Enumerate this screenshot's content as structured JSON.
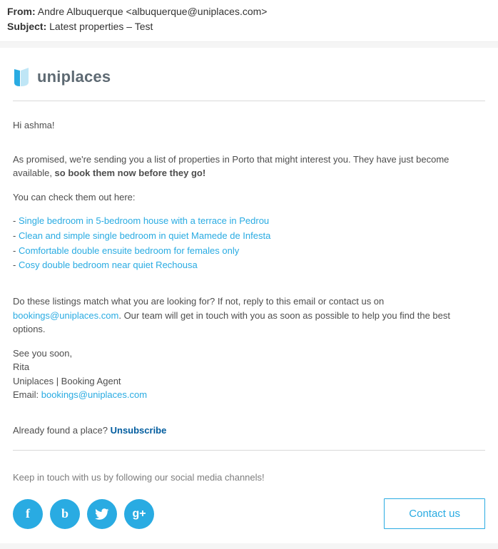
{
  "meta": {
    "from_label": "From:",
    "from_value": "Andre Albuquerque <albuquerque@uniplaces.com>",
    "subject_label": "Subject:",
    "subject_value": "Latest properties – Test"
  },
  "brand": {
    "name": "uniplaces",
    "accent": "#29abe2"
  },
  "email": {
    "greeting": "Hi ashma!",
    "intro_pre": "As promised, we're sending you a list of properties in Porto that might interest you. They have just become available, ",
    "intro_strong": "so book them now before they go!",
    "check_text": "You can check them out here:",
    "listings": [
      "Single bedroom in 5-bedroom house with a terrace in Pedrou",
      "Clean and simple single bedroom in quiet Mamede de Infesta",
      "Comfortable double ensuite bedroom for females only",
      "Cosy double bedroom near quiet Rechousa"
    ],
    "match_pre": "Do these listings match what you are looking for? If not, reply to this email or contact us on ",
    "match_email": "bookings@uniplaces.com",
    "match_post": ". Our team will get in touch with you as soon as possible to help you find the best options.",
    "signoff": {
      "l1": "See you soon,",
      "l2": "Rita",
      "l3": "Uniplaces | Booking Agent",
      "l4_label": "Email: ",
      "l4_email": "bookings@uniplaces.com"
    },
    "unsub_pre": "Already found a place? ",
    "unsub_link": "Unsubscribe"
  },
  "footer": {
    "social_text": "Keep in touch with us by following our social media channels!",
    "contact_btn": "Contact us",
    "icons": {
      "fb": "f",
      "blog": "b",
      "gplus": "g+"
    }
  }
}
